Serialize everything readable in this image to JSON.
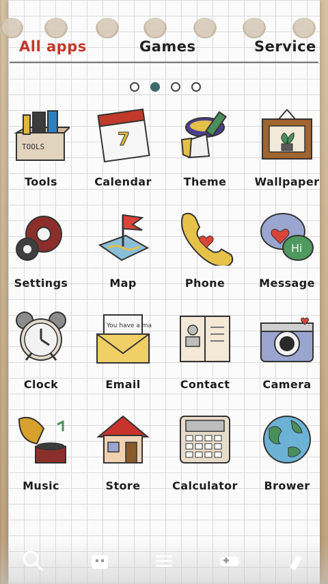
{
  "tabs": [
    {
      "label": "All apps",
      "active": true
    },
    {
      "label": "Games",
      "active": false
    },
    {
      "label": "Service",
      "active": false
    }
  ],
  "page_indicator": {
    "total": 4,
    "current": 2
  },
  "apps": [
    {
      "label": "Tools",
      "icon": "toolbox-icon"
    },
    {
      "label": "Calendar",
      "icon": "calendar-icon"
    },
    {
      "label": "Theme",
      "icon": "paint-brush-icon"
    },
    {
      "label": "Wallpaper",
      "icon": "picture-frame-icon"
    },
    {
      "label": "Settings",
      "icon": "gear-icon"
    },
    {
      "label": "Map",
      "icon": "map-flag-icon"
    },
    {
      "label": "Phone",
      "icon": "phone-handset-icon"
    },
    {
      "label": "Message",
      "icon": "chat-bubbles-icon"
    },
    {
      "label": "Clock",
      "icon": "alarm-clock-icon"
    },
    {
      "label": "Email",
      "icon": "envelope-letter-icon"
    },
    {
      "label": "Contact",
      "icon": "address-book-icon"
    },
    {
      "label": "Camera",
      "icon": "camera-icon"
    },
    {
      "label": "Music",
      "icon": "gramophone-icon"
    },
    {
      "label": "Store",
      "icon": "house-store-icon"
    },
    {
      "label": "Calculator",
      "icon": "calculator-icon"
    },
    {
      "label": "Brower",
      "icon": "globe-icon"
    }
  ],
  "dock": [
    {
      "icon": "search-icon"
    },
    {
      "icon": "android-icon"
    },
    {
      "icon": "menu-icon"
    },
    {
      "icon": "gamepad-icon"
    },
    {
      "icon": "cleaner-icon"
    }
  ],
  "icon_text": {
    "tools_box": "TOOLS",
    "calendar_day": "7",
    "message_hi": "Hi",
    "email_note": "You have a mail!"
  },
  "colors": {
    "active_tab": "#c0392b",
    "page_dot_active": "#3d6b6b"
  }
}
